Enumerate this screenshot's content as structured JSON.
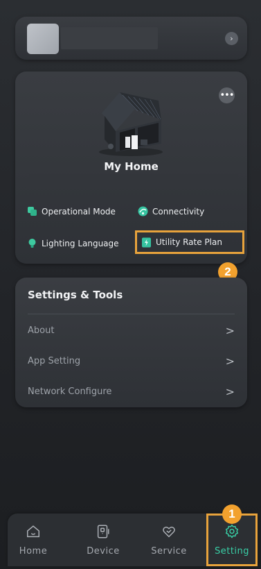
{
  "profile": {
    "chevron": "›"
  },
  "home": {
    "more": "•••",
    "name": "My Home",
    "features": {
      "operational_mode": "Operational Mode",
      "connectivity": "Connectivity",
      "lighting_language": "Lighting Language",
      "utility_rate_plan": "Utility Rate Plan"
    }
  },
  "settings": {
    "title": "Settings & Tools",
    "items": [
      {
        "label": "About",
        "arrow": ">"
      },
      {
        "label": "App Setting",
        "arrow": ">"
      },
      {
        "label": "Network Configure",
        "arrow": ">"
      }
    ]
  },
  "callouts": {
    "step1": "1",
    "step2": "2"
  },
  "nav": {
    "items": [
      {
        "label": "Home",
        "icon": "home-icon"
      },
      {
        "label": "Device",
        "icon": "device-icon"
      },
      {
        "label": "Service",
        "icon": "service-icon"
      },
      {
        "label": "Setting",
        "icon": "gear-icon"
      }
    ],
    "active": "Setting"
  },
  "colors": {
    "accent": "#39d0a7",
    "highlight": "#e8a33c",
    "badge": "#f2a12e",
    "background": "#222428"
  }
}
